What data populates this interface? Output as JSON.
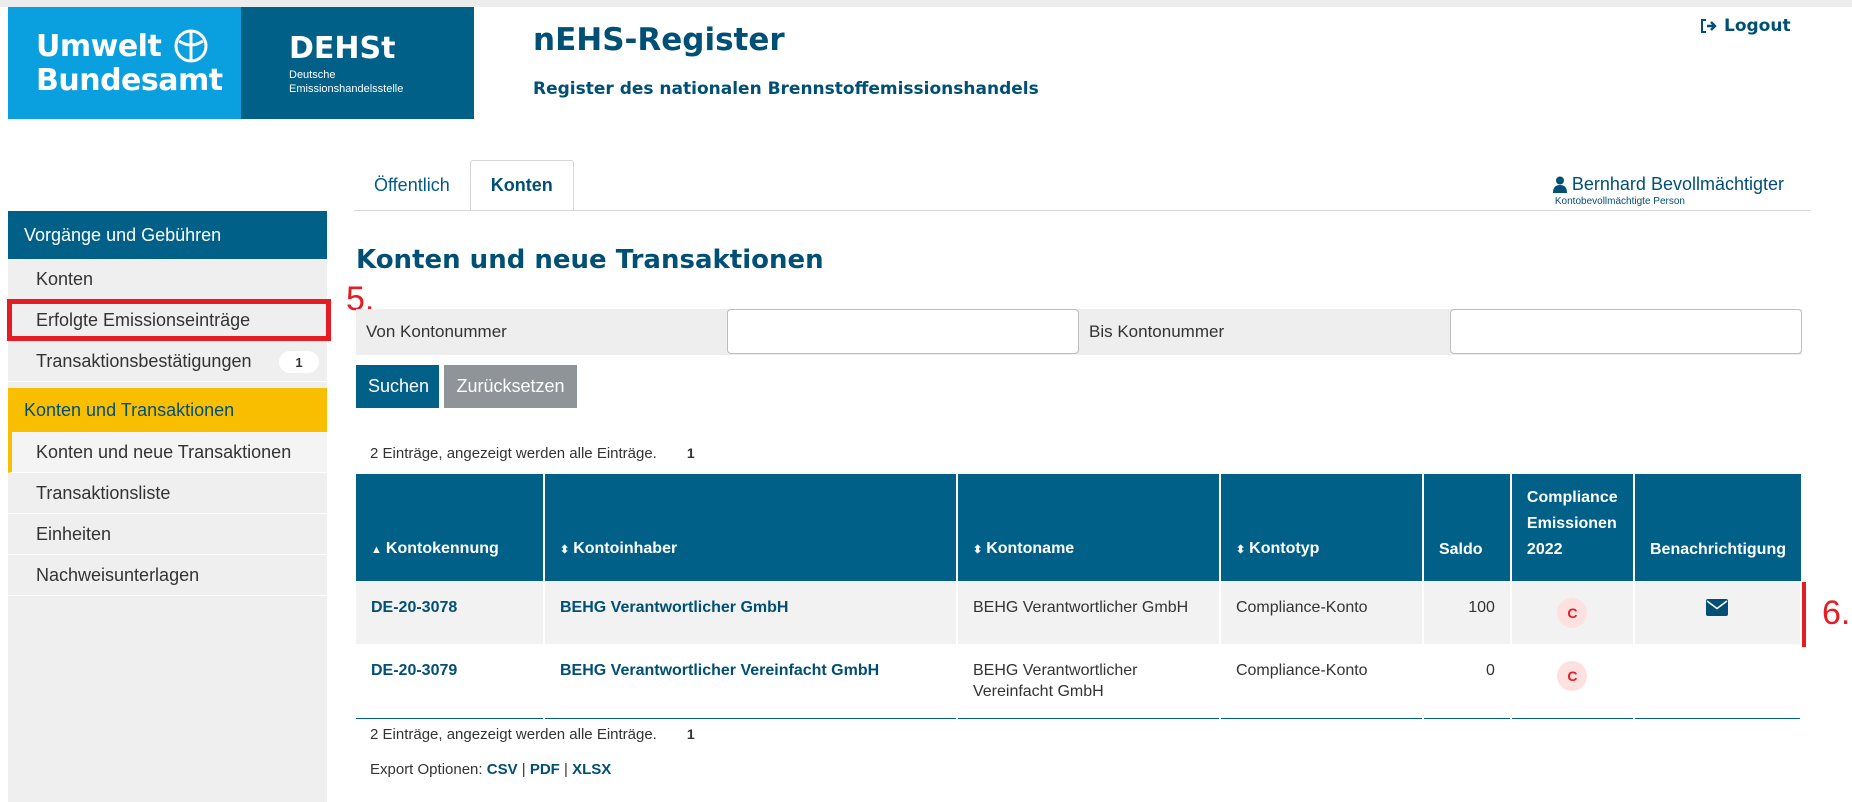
{
  "header": {
    "logo_uba_line1": "Umwelt",
    "logo_uba_line2": "Bundesamt",
    "logo_dehst_title": "DEHSt",
    "logo_dehst_sub1": "Deutsche",
    "logo_dehst_sub2": "Emissionshandelsstelle",
    "app_title": "nEHS-Register",
    "app_subtitle": "Register des nationalen Brennstoffemissionshandels",
    "logout_label": "Logout"
  },
  "tabs": [
    {
      "label": "Öffentlich"
    },
    {
      "label": "Konten"
    }
  ],
  "user": {
    "name": "Bernhard Bevollmächtigter",
    "role": "Kontobevollmächtigte Person"
  },
  "sidebar": {
    "section1": "Vorgänge und Gebühren",
    "section1_items": [
      {
        "label": "Konten"
      },
      {
        "label": "Erfolgte Emissionseinträge"
      },
      {
        "label": "Transaktionsbestätigungen",
        "badge": "1"
      }
    ],
    "section2": "Konten und Transaktionen",
    "section2_items": [
      {
        "label": "Konten und neue Transaktionen"
      },
      {
        "label": "Transaktionsliste"
      },
      {
        "label": "Einheiten"
      },
      {
        "label": "Nachweisunterlagen"
      }
    ]
  },
  "annotations": {
    "step5": "5.",
    "step6": "6."
  },
  "main": {
    "title": "Konten und neue Transaktionen",
    "filter": {
      "from_label": "Von Kontonummer",
      "from_value": "",
      "to_label": "Bis Kontonummer",
      "to_value": ""
    },
    "search_button": "Suchen",
    "reset_button": "Zurücksetzen",
    "info_text": "2 Einträge, angezeigt werden alle Einträge.",
    "page": "1",
    "columns": [
      "Kontokennung",
      "Kontoinhaber",
      "Kontoname",
      "Kontotyp",
      "Saldo",
      "Compliance Emissionen 2022",
      "Benachrichtigung"
    ],
    "rows": [
      {
        "id": "DE-20-3078",
        "holder": "BEHG Verantwortlicher GmbH",
        "name": "BEHG Verantwortlicher GmbH",
        "type": "Compliance-Konto",
        "saldo": "100",
        "compliance": "C"
      },
      {
        "id": "DE-20-3079",
        "holder": "BEHG Verantwortlicher Vereinfacht GmbH",
        "name": "BEHG Verantwortlicher Vereinfacht GmbH",
        "type": "Compliance-Konto",
        "saldo": "0",
        "compliance": "C"
      }
    ],
    "export": {
      "label": "Export Optionen:",
      "csv": "CSV",
      "pdf": "PDF",
      "xlsx": "XLSX"
    }
  },
  "colors": {
    "primary": "#006088",
    "accent": "#f9be00",
    "uba_blue": "#0a9fde",
    "highlight_red": "#e51c23"
  }
}
